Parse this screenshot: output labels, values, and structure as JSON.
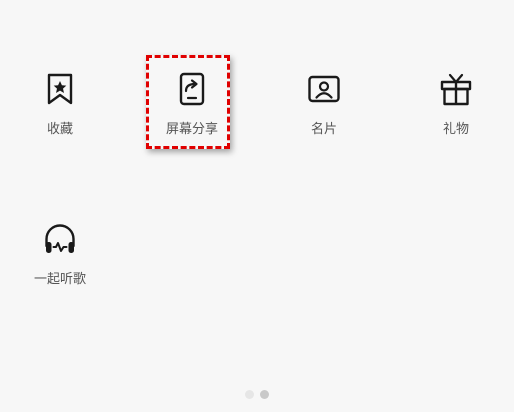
{
  "items": [
    {
      "label": "收藏",
      "icon": "bookmark-star-icon"
    },
    {
      "label": "屏幕分享",
      "icon": "screen-share-icon"
    },
    {
      "label": "名片",
      "icon": "contact-card-icon"
    },
    {
      "label": "礼物",
      "icon": "gift-icon"
    },
    {
      "label": "一起听歌",
      "icon": "headphones-icon"
    }
  ],
  "pager": {
    "pages": 2,
    "current": 2
  },
  "colors": {
    "highlight": "#e00000",
    "background": "#f7f7f7",
    "icon": "#1a1a1a",
    "label": "#555555"
  }
}
